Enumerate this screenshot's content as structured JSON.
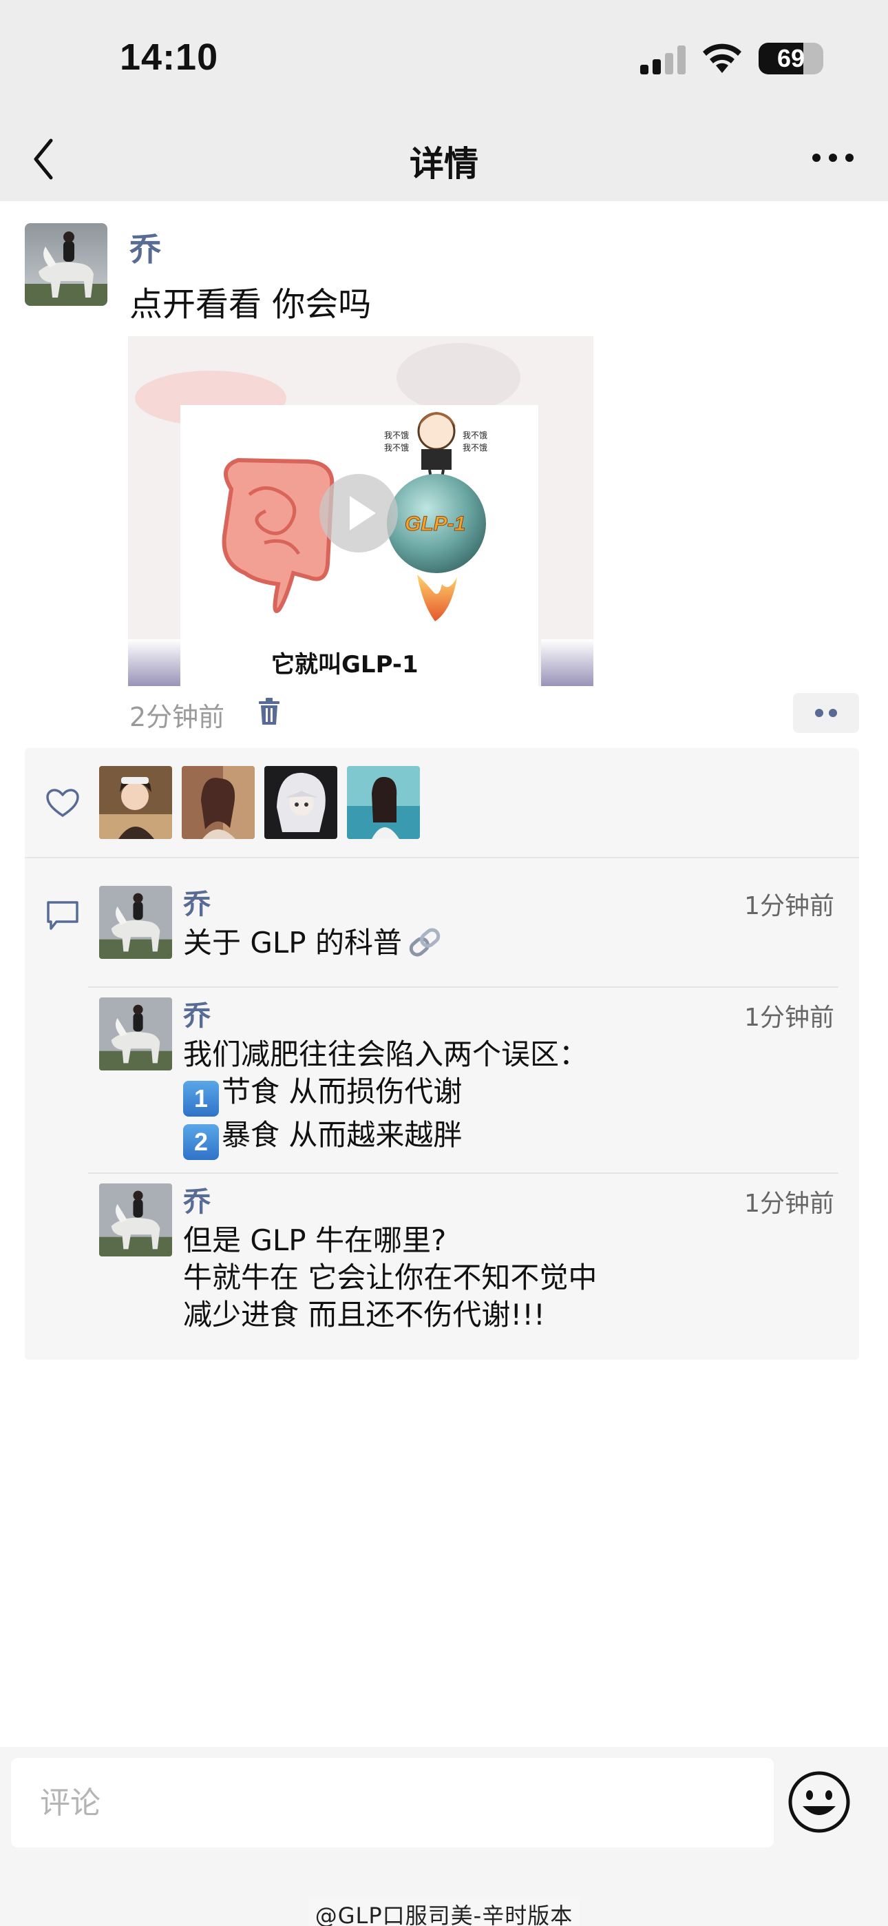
{
  "status_bar": {
    "time": "14:10",
    "battery": "69",
    "icons": [
      "signal-icon",
      "wifi-icon",
      "battery-icon"
    ]
  },
  "nav": {
    "title": "详情",
    "back_icon": "back-chevron-icon",
    "more_icon": "more-dots-icon"
  },
  "post": {
    "author": "乔",
    "text": "点开看看 你会吗",
    "video": {
      "caption": "它就叫GLP-1",
      "label_ball": "GLP-1",
      "speech": [
        "我不饿",
        "我不饿",
        "我不饿",
        "我不饿"
      ],
      "play_icon": "play-icon"
    },
    "time": "2分钟前",
    "delete_icon": "trash-icon",
    "options_icon": "two-dots-icon"
  },
  "likes": {
    "icon": "heart-icon",
    "avatar_count": 4
  },
  "comments": {
    "icon": "comment-icon",
    "items": [
      {
        "author": "乔",
        "time": "1分钟前",
        "lines": [
          "关于 GLP 的科普"
        ],
        "has_link_icon": true
      },
      {
        "author": "乔",
        "time": "1分钟前",
        "lines": [
          "我们减肥往往会陷入两个误区：",
          "节食 从而损伤代谢",
          "暴食 从而越来越胖"
        ],
        "badges": [
          "1",
          "2"
        ]
      },
      {
        "author": "乔",
        "time": "1分钟前",
        "lines": [
          "但是 GLP 牛在哪里?",
          "牛就牛在 它会让你在不知不觉中",
          "减少进食 而且还不伤代谢!!!"
        ]
      }
    ]
  },
  "bottom": {
    "placeholder": "评论",
    "emoji_icon": "smiley-icon",
    "watermark": "@GLP口服司美-辛时版本"
  },
  "colors": {
    "nav_bg": "#ededed",
    "name_blue": "#576b95",
    "panel_bg": "#f6f6f6"
  }
}
